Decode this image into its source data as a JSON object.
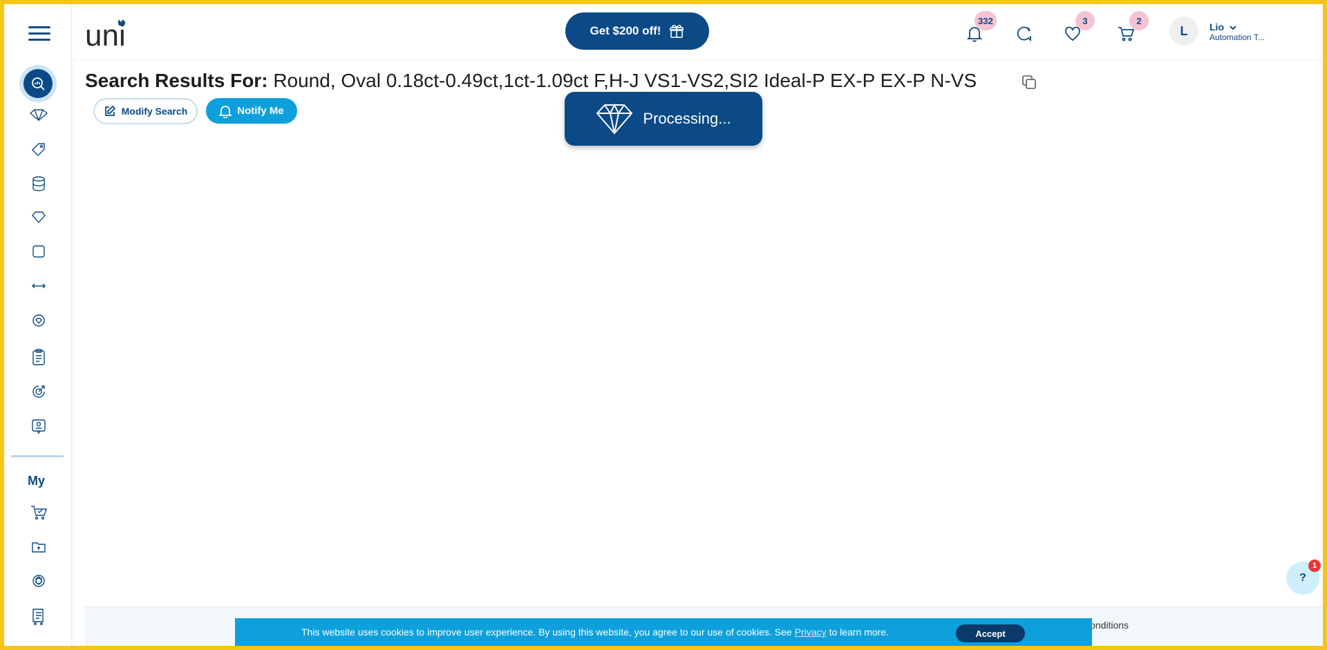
{
  "header": {
    "logo_text": "uni",
    "promo_label": "Get $200 off!",
    "notifications_count": "332",
    "favorites_count": "3",
    "cart_count": "2",
    "user": {
      "initial": "L",
      "name": "Lio",
      "subtitle": "Automation T..."
    }
  },
  "sidebar": {
    "my_label": "My",
    "icons": [
      "search-analytics-icon",
      "diamond-handshake-icon",
      "tag-icon",
      "database-icon",
      "heart-icon",
      "square-icon",
      "exchange-arrows-icon",
      "gem-badge-icon",
      "clipboard-icon",
      "target-icon",
      "id-card-icon",
      "cart-check-icon",
      "folder-icon",
      "box-target-icon",
      "list-cart-icon"
    ]
  },
  "main": {
    "title_prefix": "Search Results For:",
    "title_query": "Round, Oval 0.18ct-0.49ct,1ct-1.09ct F,H-J VS1-VS2,SI2 Ideal-P EX-P EX-P N-VS",
    "modify_label": "Modify Search",
    "notify_label": "Notify Me",
    "processing_label": "Processing..."
  },
  "footer": {
    "conditions_text": "onditions"
  },
  "cookie": {
    "text_before": "This website uses cookies to improve user experience. By using this website, you agree to our use of cookies. See",
    "privacy_link": "Privacy",
    "text_after": "to learn more.",
    "accept_label": "Accept"
  },
  "help": {
    "label": "?",
    "badge": "1"
  },
  "colors": {
    "brand": "#0b4a86",
    "accent": "#0ea0dc",
    "frame": "#f5c518",
    "badge": "#f6c3d3"
  }
}
